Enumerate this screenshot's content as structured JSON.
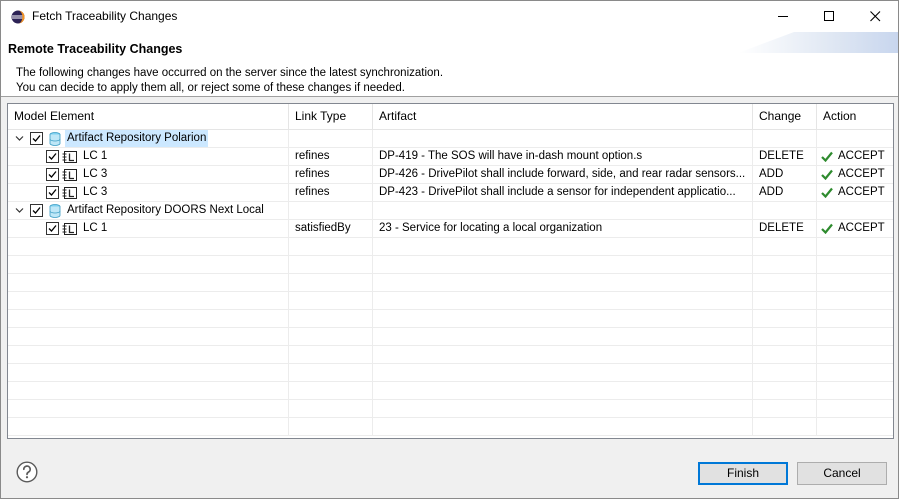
{
  "window": {
    "title": "Fetch Traceability Changes"
  },
  "header": {
    "title": "Remote Traceability Changes",
    "line1": "The following changes have occurred on the server since the latest synchronization.",
    "line2": "You can decide to apply them all, or reject some of these changes if needed."
  },
  "columns": {
    "model_element": "Model Element",
    "link_type": "Link Type",
    "artifact": "Artifact",
    "change": "Change",
    "action": "Action"
  },
  "groups": [
    {
      "label": "Artifact Repository Polarion",
      "checked": true,
      "expanded": true,
      "children": [
        {
          "element": "LC 1",
          "link_type": "refines",
          "artifact": "DP-419 - The SOS will have in-dash mount option.s",
          "change": "DELETE",
          "action": "ACCEPT"
        },
        {
          "element": "LC 3",
          "link_type": "refines",
          "artifact": "DP-426 - DrivePilot shall include forward, side, and rear radar sensors...",
          "change": "ADD",
          "action": "ACCEPT"
        },
        {
          "element": "LC 3",
          "link_type": "refines",
          "artifact": "DP-423 - DrivePilot shall include a sensor for independent applicatio...",
          "change": "ADD",
          "action": "ACCEPT"
        }
      ]
    },
    {
      "label": "Artifact Repository DOORS Next Local",
      "checked": true,
      "expanded": true,
      "children": [
        {
          "element": "LC 1",
          "link_type": "satisfiedBy",
          "artifact": "23 - Service for locating a local organization",
          "change": "DELETE",
          "action": "ACCEPT"
        }
      ]
    }
  ],
  "buttons": {
    "finish": "Finish",
    "cancel": "Cancel"
  },
  "colors": {
    "selection": "#cce8ff",
    "accept_check": "#2e8b2e",
    "default_button_border": "#0078d7"
  }
}
